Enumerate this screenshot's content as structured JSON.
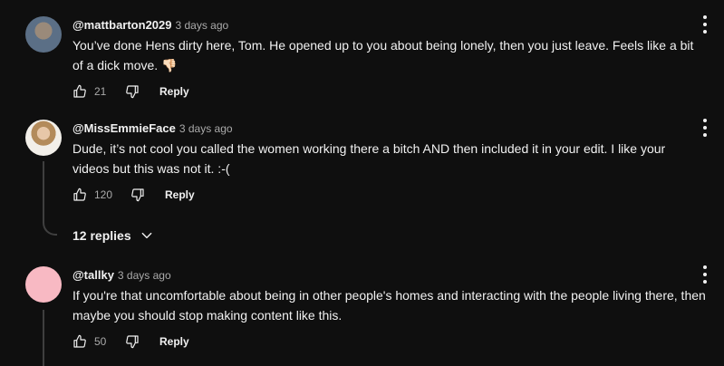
{
  "comments": [
    {
      "author": "@mattbarton2029",
      "time": "3 days ago",
      "text": "You’ve done Hens dirty here, Tom. He opened up to you about being lonely, then you just leave. Feels like a bit of a dick move. 👎🏻",
      "likes": "21",
      "reply_label": "Reply"
    },
    {
      "author": "@MissEmmieFace",
      "time": "3 days ago",
      "text": "Dude, it’s not cool you called the women working there a bitch AND then included it in your edit. I like your videos but this was not it. :-(",
      "likes": "120",
      "reply_label": "Reply",
      "replies_label": "12 replies"
    },
    {
      "author": "@tallky",
      "time": "3 days ago",
      "text": "If you're that uncomfortable about being in other people's homes and interacting with the people living there, then maybe you should stop making content like this.",
      "likes": "50",
      "reply_label": "Reply"
    }
  ]
}
